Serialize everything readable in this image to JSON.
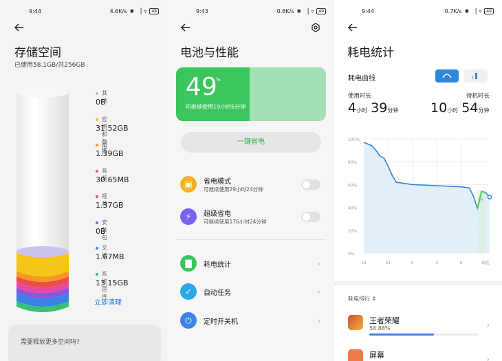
{
  "storage": {
    "status": {
      "time": "9:44",
      "speed": "4.6K/s",
      "battery": "49"
    },
    "title": "存储空间",
    "usage": "已使用58.1GB/共256GB",
    "categories": [
      {
        "label": "其他",
        "value": "0B",
        "color": "#bdbdbd"
      },
      {
        "label": "应用和数据",
        "value": "31.52GB",
        "color": "#f5c518"
      },
      {
        "label": "图片",
        "value": "1.39GB",
        "color": "#f39a1e"
      },
      {
        "label": "音频",
        "value": "30.65MB",
        "color": "#ee4b4b"
      },
      {
        "label": "视频",
        "value": "1.37GB",
        "color": "#e64aa0"
      },
      {
        "label": "安装包",
        "value": "0B",
        "color": "#8b56d8"
      },
      {
        "label": "文档",
        "value": "1.67MB",
        "color": "#3a82e8"
      },
      {
        "label": "系统固件",
        "value": "13.15GB",
        "color": "#38c171"
      }
    ],
    "clean_label": "立即清理",
    "free_prompt": "需要释放更多空间吗?"
  },
  "battery": {
    "status": {
      "time": "9:43",
      "speed": "0.8K/s",
      "battery": "49"
    },
    "title": "电池与性能",
    "percent": "49",
    "percent_sign": "%",
    "level": 0.49,
    "remaining": "可继续使用19小时6分钟",
    "save_button": "一键省电",
    "modes": [
      {
        "title": "省电模式",
        "subtitle": "可继续使用29小时24分钟",
        "icon": "battery-saver-icon",
        "color": "#f5b21e",
        "enabled": false
      },
      {
        "title": "超级省电",
        "subtitle": "可继续使用176小时24分钟",
        "icon": "lightning-icon",
        "color": "#7b61f0",
        "enabled": false
      }
    ],
    "menu": [
      {
        "label": "耗电统计",
        "icon": "bar-chart-icon",
        "color": "#3cc55d"
      },
      {
        "label": "自动任务",
        "icon": "task-clipboard-icon",
        "color": "#2fa6e8"
      },
      {
        "label": "定时开关机",
        "icon": "power-icon",
        "color": "#3d84e6"
      }
    ]
  },
  "stats": {
    "status": {
      "time": "9:44",
      "speed": "0.7K/s",
      "battery": "49"
    },
    "title": "耗电统计",
    "curve_label": "耗电曲线",
    "screen_on_label": "使用时长",
    "screen_on": {
      "h": "4",
      "h_unit": "小时",
      "m": "39",
      "m_unit": "分钟"
    },
    "standby_label": "待机时长",
    "standby": {
      "h": "10",
      "h_unit": "小时",
      "m": "54",
      "m_unit": "分钟"
    },
    "rank_label": "耗电排行",
    "apps": [
      {
        "name": "王者荣耀",
        "percent": "58.88%",
        "share": 0.5888,
        "icon": "game-icon"
      },
      {
        "name": "屏幕",
        "icon": "screen-icon"
      }
    ]
  },
  "chart_data": {
    "type": "line",
    "title": "",
    "xlabel": "",
    "ylabel": "",
    "x_ticks": [
      "18",
      "21",
      "0",
      "3",
      "6",
      "现在"
    ],
    "y_ticks": [
      "100%",
      "80%",
      "60%",
      "40%",
      "20%",
      "0%"
    ],
    "ylim": [
      0,
      100
    ],
    "series": [
      {
        "x": [
          "18:00",
          "19:00",
          "19:30",
          "20:00",
          "20:30",
          "21:00",
          "21:30",
          "22:00",
          "0:00",
          "3:00",
          "6:00",
          "7:00",
          "7:30",
          "8:00",
          "8:30",
          "9:00",
          "9:30"
        ],
        "values": [
          97,
          94,
          90,
          85,
          83,
          76,
          68,
          62,
          60,
          59,
          58,
          57,
          50,
          39,
          54,
          53,
          49
        ]
      }
    ],
    "charging_segment": {
      "x_start": "8:00",
      "x_end": "9:00",
      "color": "#3cc55d"
    },
    "line_color": "#2f86dd",
    "grid": true
  }
}
